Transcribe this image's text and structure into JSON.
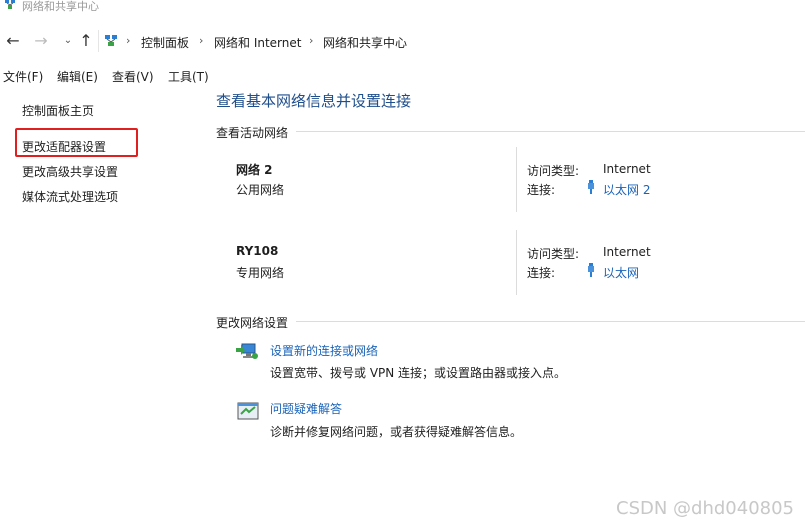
{
  "window": {
    "title": "网络和共享中心"
  },
  "address_bar": {
    "breadcrumbs": [
      "控制面板",
      "网络和 Internet",
      "网络和共享中心"
    ]
  },
  "menu": [
    "文件(F)",
    "编辑(E)",
    "查看(V)",
    "工具(T)"
  ],
  "left_pane": {
    "links": [
      "控制面板主页",
      "更改适配器设置",
      "更改高级共享设置",
      "媒体流式处理选项"
    ],
    "highlighted": "更改适配器设置",
    "highlight_color": "#e02020"
  },
  "main": {
    "title": "查看基本网络信息并设置连接",
    "active_networks_heading": "查看活动网络",
    "networks": [
      {
        "name": "网络 2",
        "category": "公用网络",
        "access_label": "访问类型:",
        "access_value": "Internet",
        "conn_label": "连接:",
        "conn_value": "以太网 2"
      },
      {
        "name": "RY108",
        "category": "专用网络",
        "access_label": "访问类型:",
        "access_value": "Internet",
        "conn_label": "连接:",
        "conn_value": "以太网"
      }
    ],
    "change_settings_heading": "更改网络设置",
    "tasks": [
      {
        "title": "设置新的连接或网络",
        "desc": "设置宽带、拨号或 VPN 连接；或设置路由器或接入点。",
        "icon": "network-setup-icon"
      },
      {
        "title": "问题疑难解答",
        "desc": "诊断并修复网络问题，或者获得疑难解答信息。",
        "icon": "troubleshoot-icon"
      }
    ]
  },
  "colors": {
    "link": "#1a63b8",
    "title": "#1e4e8c"
  },
  "watermark": "CSDN @dhd040805"
}
